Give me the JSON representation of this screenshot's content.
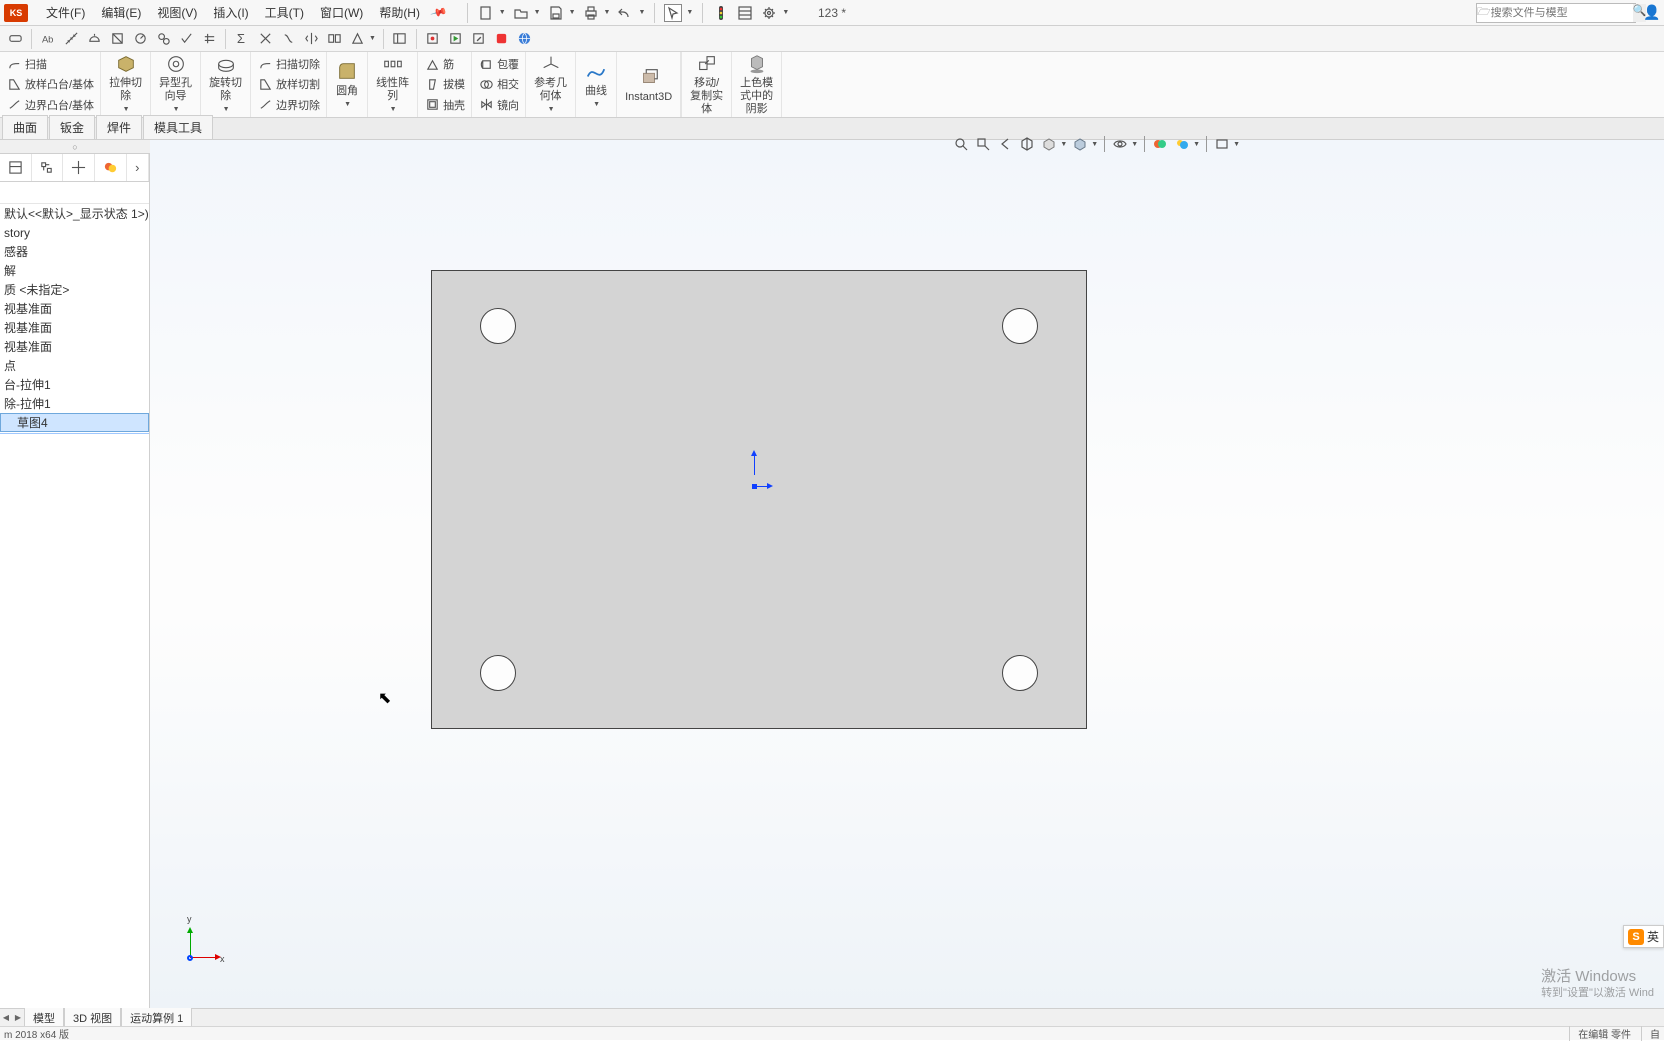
{
  "app": {
    "logo": "KS"
  },
  "menu": {
    "file": "文件(F)",
    "edit": "编辑(E)",
    "view": "视图(V)",
    "insert": "插入(I)",
    "tools": "工具(T)",
    "window": "窗口(W)",
    "help": "帮助(H)"
  },
  "doc_title": "123 *",
  "search": {
    "placeholder": "搜索文件与模型"
  },
  "ribbon": {
    "g1": {
      "r1": "扫描",
      "r2": "放样凸台/基体",
      "r3": "边界凸台/基体"
    },
    "g2": "拉伸切\n除",
    "g3": "异型孔\n向导",
    "g4": "旋转切\n除",
    "g5": {
      "r1": "扫描切除",
      "r2": "放样切割",
      "r3": "边界切除"
    },
    "g6": "圆角",
    "g7": "线性阵\n列",
    "g8": {
      "r1": "筋",
      "r2": "拔模",
      "r3": "抽壳"
    },
    "g9": {
      "r1": "包覆",
      "r2": "相交",
      "r3": "镜向"
    },
    "g10": "参考几\n何体",
    "g11": "曲线",
    "g12": "Instant3D",
    "g13": "移动/\n复制实\n体",
    "g14": "上色模\n式中的\n阴影"
  },
  "tabs": {
    "t1": "曲面",
    "t2": "钣金",
    "t3": "焊件",
    "t4": "模具工具"
  },
  "tree": {
    "root": "默认<<默认>_显示状态 1>)",
    "n1": "story",
    "n2": "感器",
    "n3": "解",
    "n4": "质 <未指定>",
    "n5": "视基准面",
    "n6": "视基准面",
    "n7": "视基准面",
    "n8": "点",
    "n9": "台-拉伸1",
    "n10": "除-拉伸1",
    "n11": "草图4"
  },
  "triad": {
    "y": "y",
    "x": "x"
  },
  "ime": "英",
  "watermark": {
    "l1": "激活 Windows",
    "l2": "转到\"设置\"以激活 Wind"
  },
  "btabs": {
    "t1": "模型",
    "t2": "3D 视图",
    "t3": "运动算例 1"
  },
  "status": {
    "left": "m 2018 x64 版",
    "r1": "在编辑 零件",
    "r2": "自"
  }
}
